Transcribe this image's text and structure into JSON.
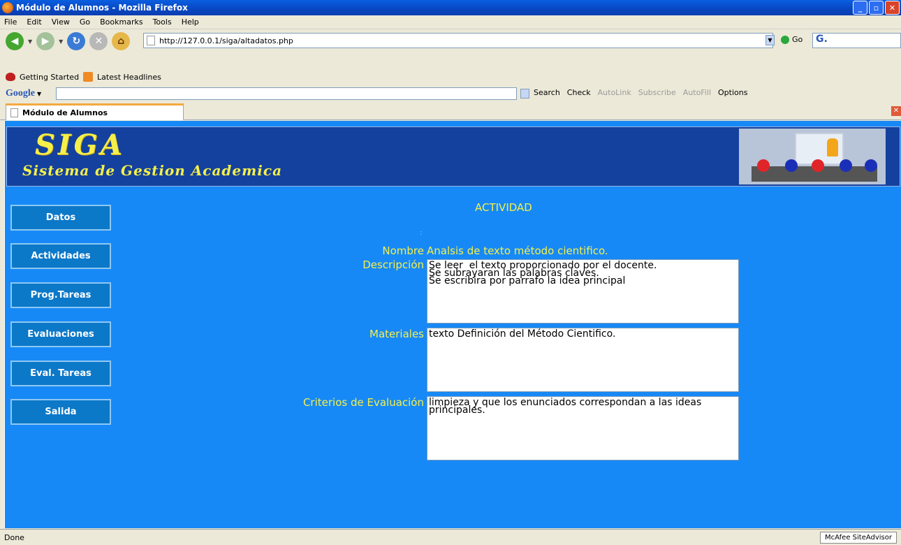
{
  "window": {
    "title": "Módulo de Alumnos - Mozilla Firefox"
  },
  "menu": [
    "File",
    "Edit",
    "View",
    "Go",
    "Bookmarks",
    "Tools",
    "Help"
  ],
  "navbar": {
    "url": "http://127.0.0.1/siga/altadatos.php",
    "go_label": "Go"
  },
  "bookmarks": [
    "Getting Started",
    "Latest Headlines"
  ],
  "google_toolbar": {
    "logo": "Google",
    "tools": [
      "Search",
      "Check",
      "AutoLink",
      "Subscribe",
      "AutoFill",
      "Options"
    ]
  },
  "tab": {
    "label": "Módulo de Alumnos"
  },
  "banner": {
    "logo_big": "SIGA",
    "logo_sub": "Sistema de Gestion Academica"
  },
  "sidebar": [
    "Datos",
    "Actividades",
    "Prog.Tareas",
    "Evaluaciones",
    "Eval. Tareas",
    "Salida"
  ],
  "main": {
    "heading": "ACTIVIDAD",
    "colon": ":",
    "name_label": "Nombre",
    "name_value": "Analsis de texto método cientifico.",
    "desc_label": "Descripción",
    "desc_value": "Se leer  el texto proporcionado por el docente.\nSe subrayaran las palabras claves.\nSe escribira por parrafo la idea principal",
    "mat_label": "Materiales",
    "mat_value": "texto Definición del Método Cientifico.",
    "crit_label": "Criterios de Evaluación",
    "crit_value": "limpieza y que los enunciados correspondan a las ideas principales."
  },
  "status": {
    "text": "Done",
    "addon": "McAfee SiteAdvisor"
  }
}
